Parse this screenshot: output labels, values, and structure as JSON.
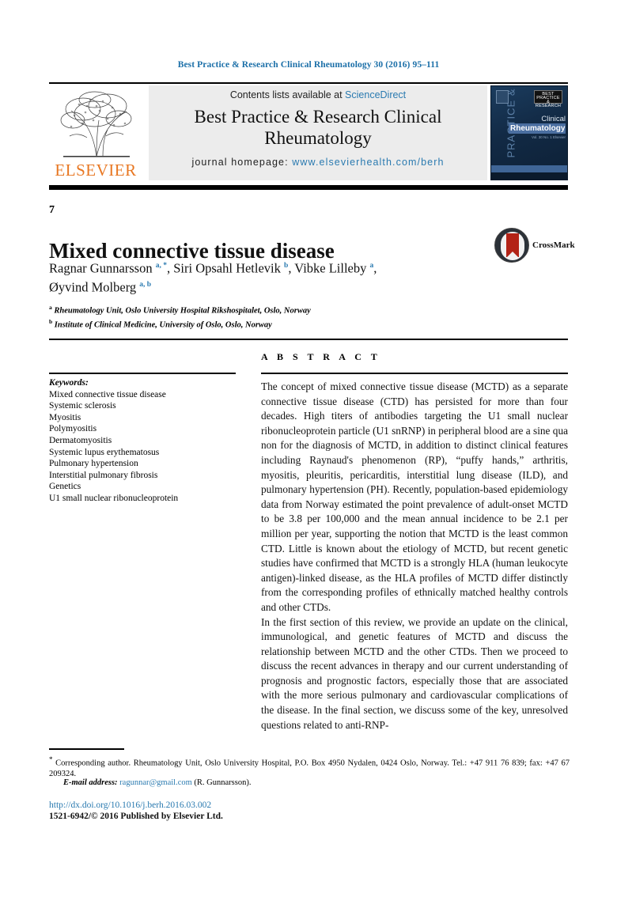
{
  "running_head": "Best Practice & Research Clinical Rheumatology 30 (2016) 95–111",
  "header": {
    "publisher_name": "ELSEVIER",
    "contents_prefix": "Contents lists available at ",
    "contents_link": "ScienceDirect",
    "journal_title": "Best Practice & Research Clinical Rheumatology",
    "homepage_prefix": "journal homepage: ",
    "homepage_url": "www.elsevierhealth.com/berh",
    "cover": {
      "vertical_text": "PRACTICE & RESEARCH",
      "badge_text": "BEST PRACTICE & RESEARCH",
      "line1": "Clinical",
      "line2": "Rheumatology",
      "sub": "Vol. 30 No. 1\nElsevier"
    }
  },
  "article": {
    "number": "7",
    "title": "Mixed connective tissue disease",
    "authors_line1_a": "Ragnar Gunnarsson ",
    "authors_line1_a_sup": "a, *",
    "authors_line1_b": ", Siri Opsahl Hetlevik ",
    "authors_line1_b_sup": "b",
    "authors_line1_c": ", Vibke Lilleby ",
    "authors_line1_c_sup": "a",
    "authors_line1_d": ",",
    "authors_line2": "Øyvind Molberg ",
    "authors_line2_sup": "a, b",
    "crossmark_label": "CrossMark",
    "affiliations": [
      {
        "marker": "a",
        "text": "Rheumatology Unit, Oslo University Hospital Rikshospitalet, Oslo, Norway"
      },
      {
        "marker": "b",
        "text": "Institute of Clinical Medicine, University of Oslo, Oslo, Norway"
      }
    ]
  },
  "keywords": {
    "heading": "Keywords:",
    "items": [
      "Mixed connective tissue disease",
      "Systemic sclerosis",
      "Myositis",
      "Polymyositis",
      "Dermatomyositis",
      "Systemic lupus erythematosus",
      "Pulmonary hypertension",
      "Interstitial pulmonary fibrosis",
      "Genetics",
      "U1 small nuclear ribonucleoprotein"
    ]
  },
  "abstract": {
    "heading": "A B S T R A C T",
    "paragraphs": [
      "The concept of mixed connective tissue disease (MCTD) as a separate connective tissue disease (CTD) has persisted for more than four decades. High titers of antibodies targeting the U1 small nuclear ribonucleoprotein particle (U1 snRNP) in peripheral blood are a sine qua non for the diagnosis of MCTD, in addition to distinct clinical features including Raynaud's phenomenon (RP), “puffy hands,” arthritis, myositis, pleuritis, pericarditis, interstitial lung disease (ILD), and pulmonary hypertension (PH). Recently, population-based epidemiology data from Norway estimated the point prevalence of adult-onset MCTD to be 3.8 per 100,000 and the mean annual incidence to be 2.1 per million per year, supporting the notion that MCTD is the least common CTD. Little is known about the etiology of MCTD, but recent genetic studies have confirmed that MCTD is a strongly HLA (human leukocyte antigen)-linked disease, as the HLA profiles of MCTD differ distinctly from the corresponding profiles of ethnically matched healthy controls and other CTDs.",
      "In the first section of this review, we provide an update on the clinical, immunological, and genetic features of MCTD and discuss the relationship between MCTD and the other CTDs. Then we proceed to discuss the recent advances in therapy and our current understanding of prognosis and prognostic factors, especially those that are associated with the more serious pulmonary and cardiovascular complications of the disease. In the final section, we discuss some of the key, unresolved questions related to anti-RNP-"
    ]
  },
  "footer": {
    "corresponding_marker": "*",
    "corresponding_text": " Corresponding author. Rheumatology Unit, Oslo University Hospital, P.O. Box 4950 Nydalen, 0424 Oslo, Norway. Tel.: +47 911 76 839; fax: +47 67 209324.",
    "email_label": "E-mail address:",
    "email_address": "ragunnar@gmail.com",
    "email_owner": "(R. Gunnarsson).",
    "doi": "http://dx.doi.org/10.1016/j.berh.2016.03.002",
    "copyright": "1521-6942/© 2016 Published by Elsevier Ltd."
  },
  "colors": {
    "link_blue": "#2a7ab0",
    "elsevier_orange": "#E87722",
    "crossmark_red": "#b32317"
  }
}
